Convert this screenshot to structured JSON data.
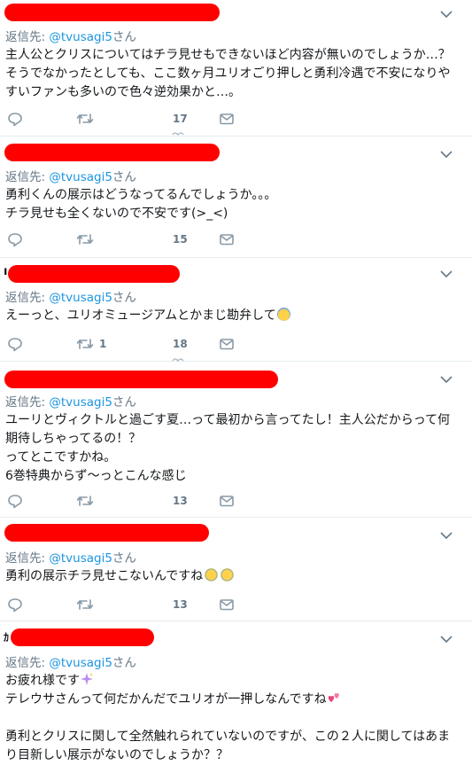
{
  "tweets": [
    {
      "reply_prefix": "返信先:",
      "reply_handle": "@tvusagi5",
      "reply_suffix": "さん",
      "text": "主人公とクリスについてはチラ見せもできないほど内容が無いのでしょうか…？\nそうでなかったとしても、ここ数ヶ月ユリオごり押しと勇利冷遇で不安になりや\nすいファンも多いので色々逆効果かと…。",
      "likes": "17",
      "retweets": ""
    },
    {
      "reply_prefix": "返信先:",
      "reply_handle": "@tvusagi5",
      "reply_suffix": "さん",
      "text": "勇利くんの展示はどうなってるんでしょうか。。。\nチラ見せも全くないので不安です(>_<)",
      "likes": "15",
      "retweets": ""
    },
    {
      "reply_prefix": "返信先:",
      "reply_handle": "@tvusagi5",
      "reply_suffix": "さん",
      "text": "えーっと、ユリオミュージアムとかまじ勘弁して",
      "emoji_end": "sweat-face",
      "likes": "18",
      "retweets": "1"
    },
    {
      "reply_prefix": "返信先:",
      "reply_handle": "@tvusagi5",
      "reply_suffix": "さん",
      "text": "ユーリとヴィクトルと過ごす夏…って最初から言ってたし！主人公だからって何\n期待しちゃってるの！？\nってとこですかね。\n6巻特典からず〜っとこんな感じ",
      "likes": "13",
      "retweets": ""
    },
    {
      "reply_prefix": "返信先:",
      "reply_handle": "@tvusagi5",
      "reply_suffix": "さん",
      "text": "勇利の展示チラ見せこないんですね",
      "emoji_end": "laughing-tears",
      "likes": "13",
      "retweets": ""
    },
    {
      "reply_prefix": "返信先:",
      "reply_handle": "@tvusagi5",
      "reply_suffix": "さん",
      "text_line1": "お疲れ様です",
      "text_line2": "テレウサさんって何だかんだでユリオが一押しなんですね",
      "text_rest": "勇利とクリスに関して全然触れられていないのですが、この２人に関してはあま\nり目新しい展示がないのでしょうか？？"
    }
  ],
  "colors": {
    "redaction": "#ff0000",
    "link": "#1b95e0",
    "muted": "#657786",
    "icon": "#8899a6"
  }
}
